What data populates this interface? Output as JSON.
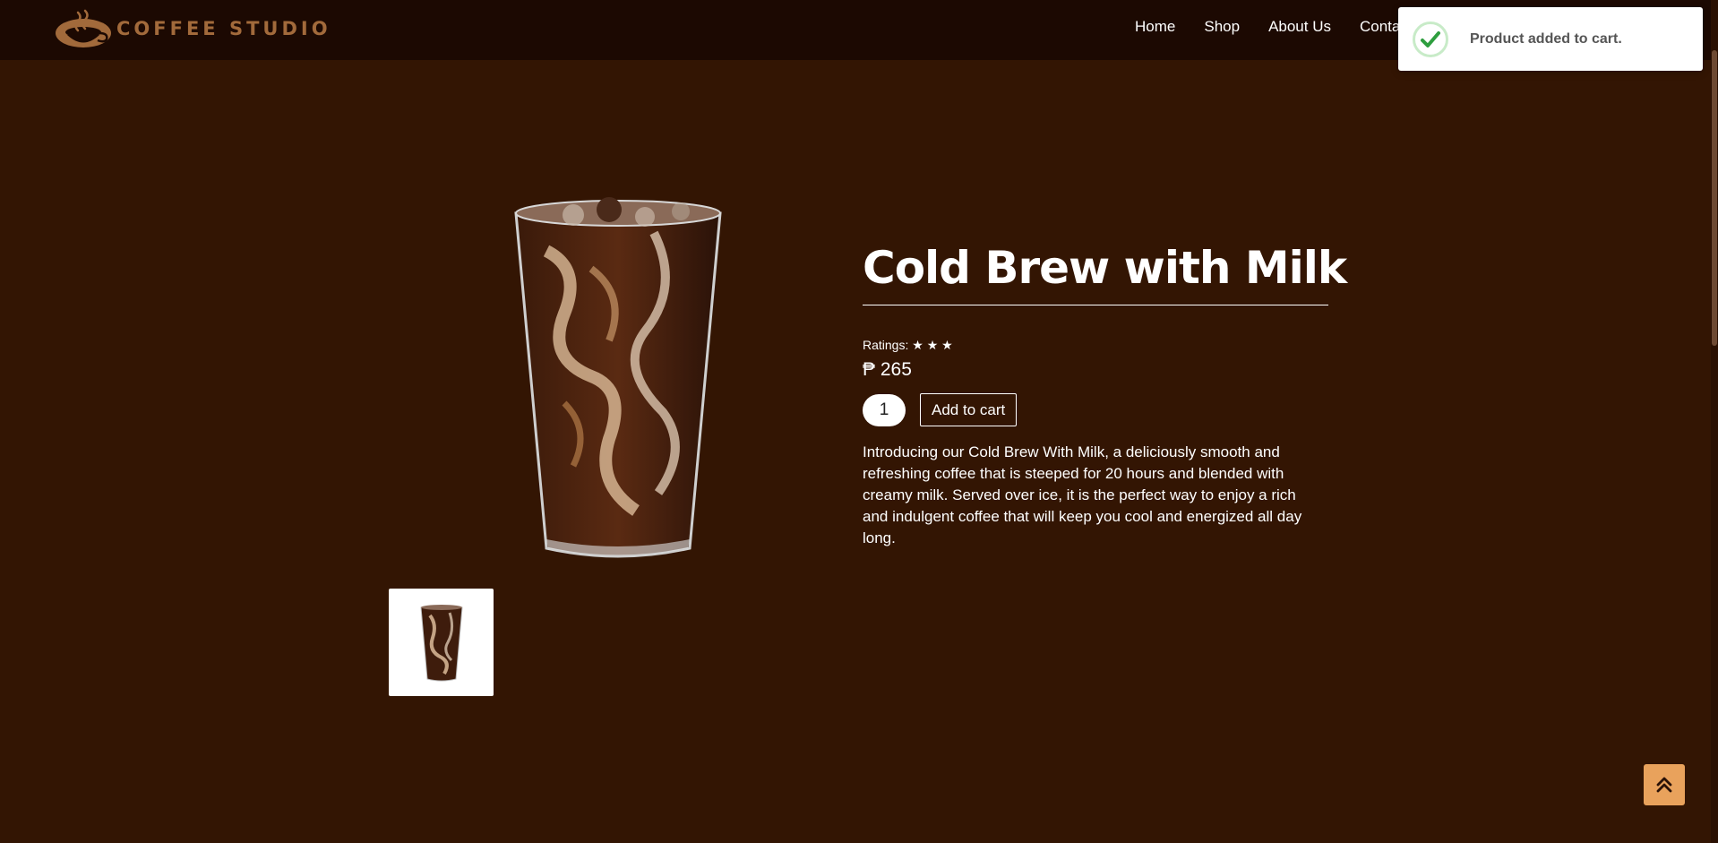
{
  "brand": {
    "name": "COFFEE STUDIO",
    "logo_icon": "coffee-cup-logo-icon"
  },
  "nav": {
    "items": [
      {
        "label": "Home"
      },
      {
        "label": "Shop"
      },
      {
        "label": "About Us"
      },
      {
        "label": "Contact"
      }
    ]
  },
  "toast": {
    "message": "Product added to cart.",
    "icon": "check-icon"
  },
  "product": {
    "title": "Cold Brew with Milk",
    "ratings_label": "Ratings:",
    "ratings_stars": "★ ★ ★",
    "rating": 3,
    "price": "₱ 265",
    "quantity": "1",
    "add_to_cart_label": "Add to cart",
    "description": "Introducing our Cold Brew With Milk, a deliciously smooth and refreshing coffee that is steeped for 20 hours and blended with creamy milk. Served over ice, it is the perfect way to enjoy a rich and indulgent coffee that will keep you cool and energized all day long.",
    "image_icon": "iced-coffee-glass-image",
    "thumbnail_icon": "iced-coffee-thumbnail"
  },
  "back_to_top": {
    "icon": "double-chevron-up-icon"
  },
  "colors": {
    "page_background": "#331503",
    "header_background": "#1c0902",
    "brand_accent": "#a26a3b",
    "back_to_top_background": "#e9a25c",
    "toast_success": "#2e9e3f"
  }
}
